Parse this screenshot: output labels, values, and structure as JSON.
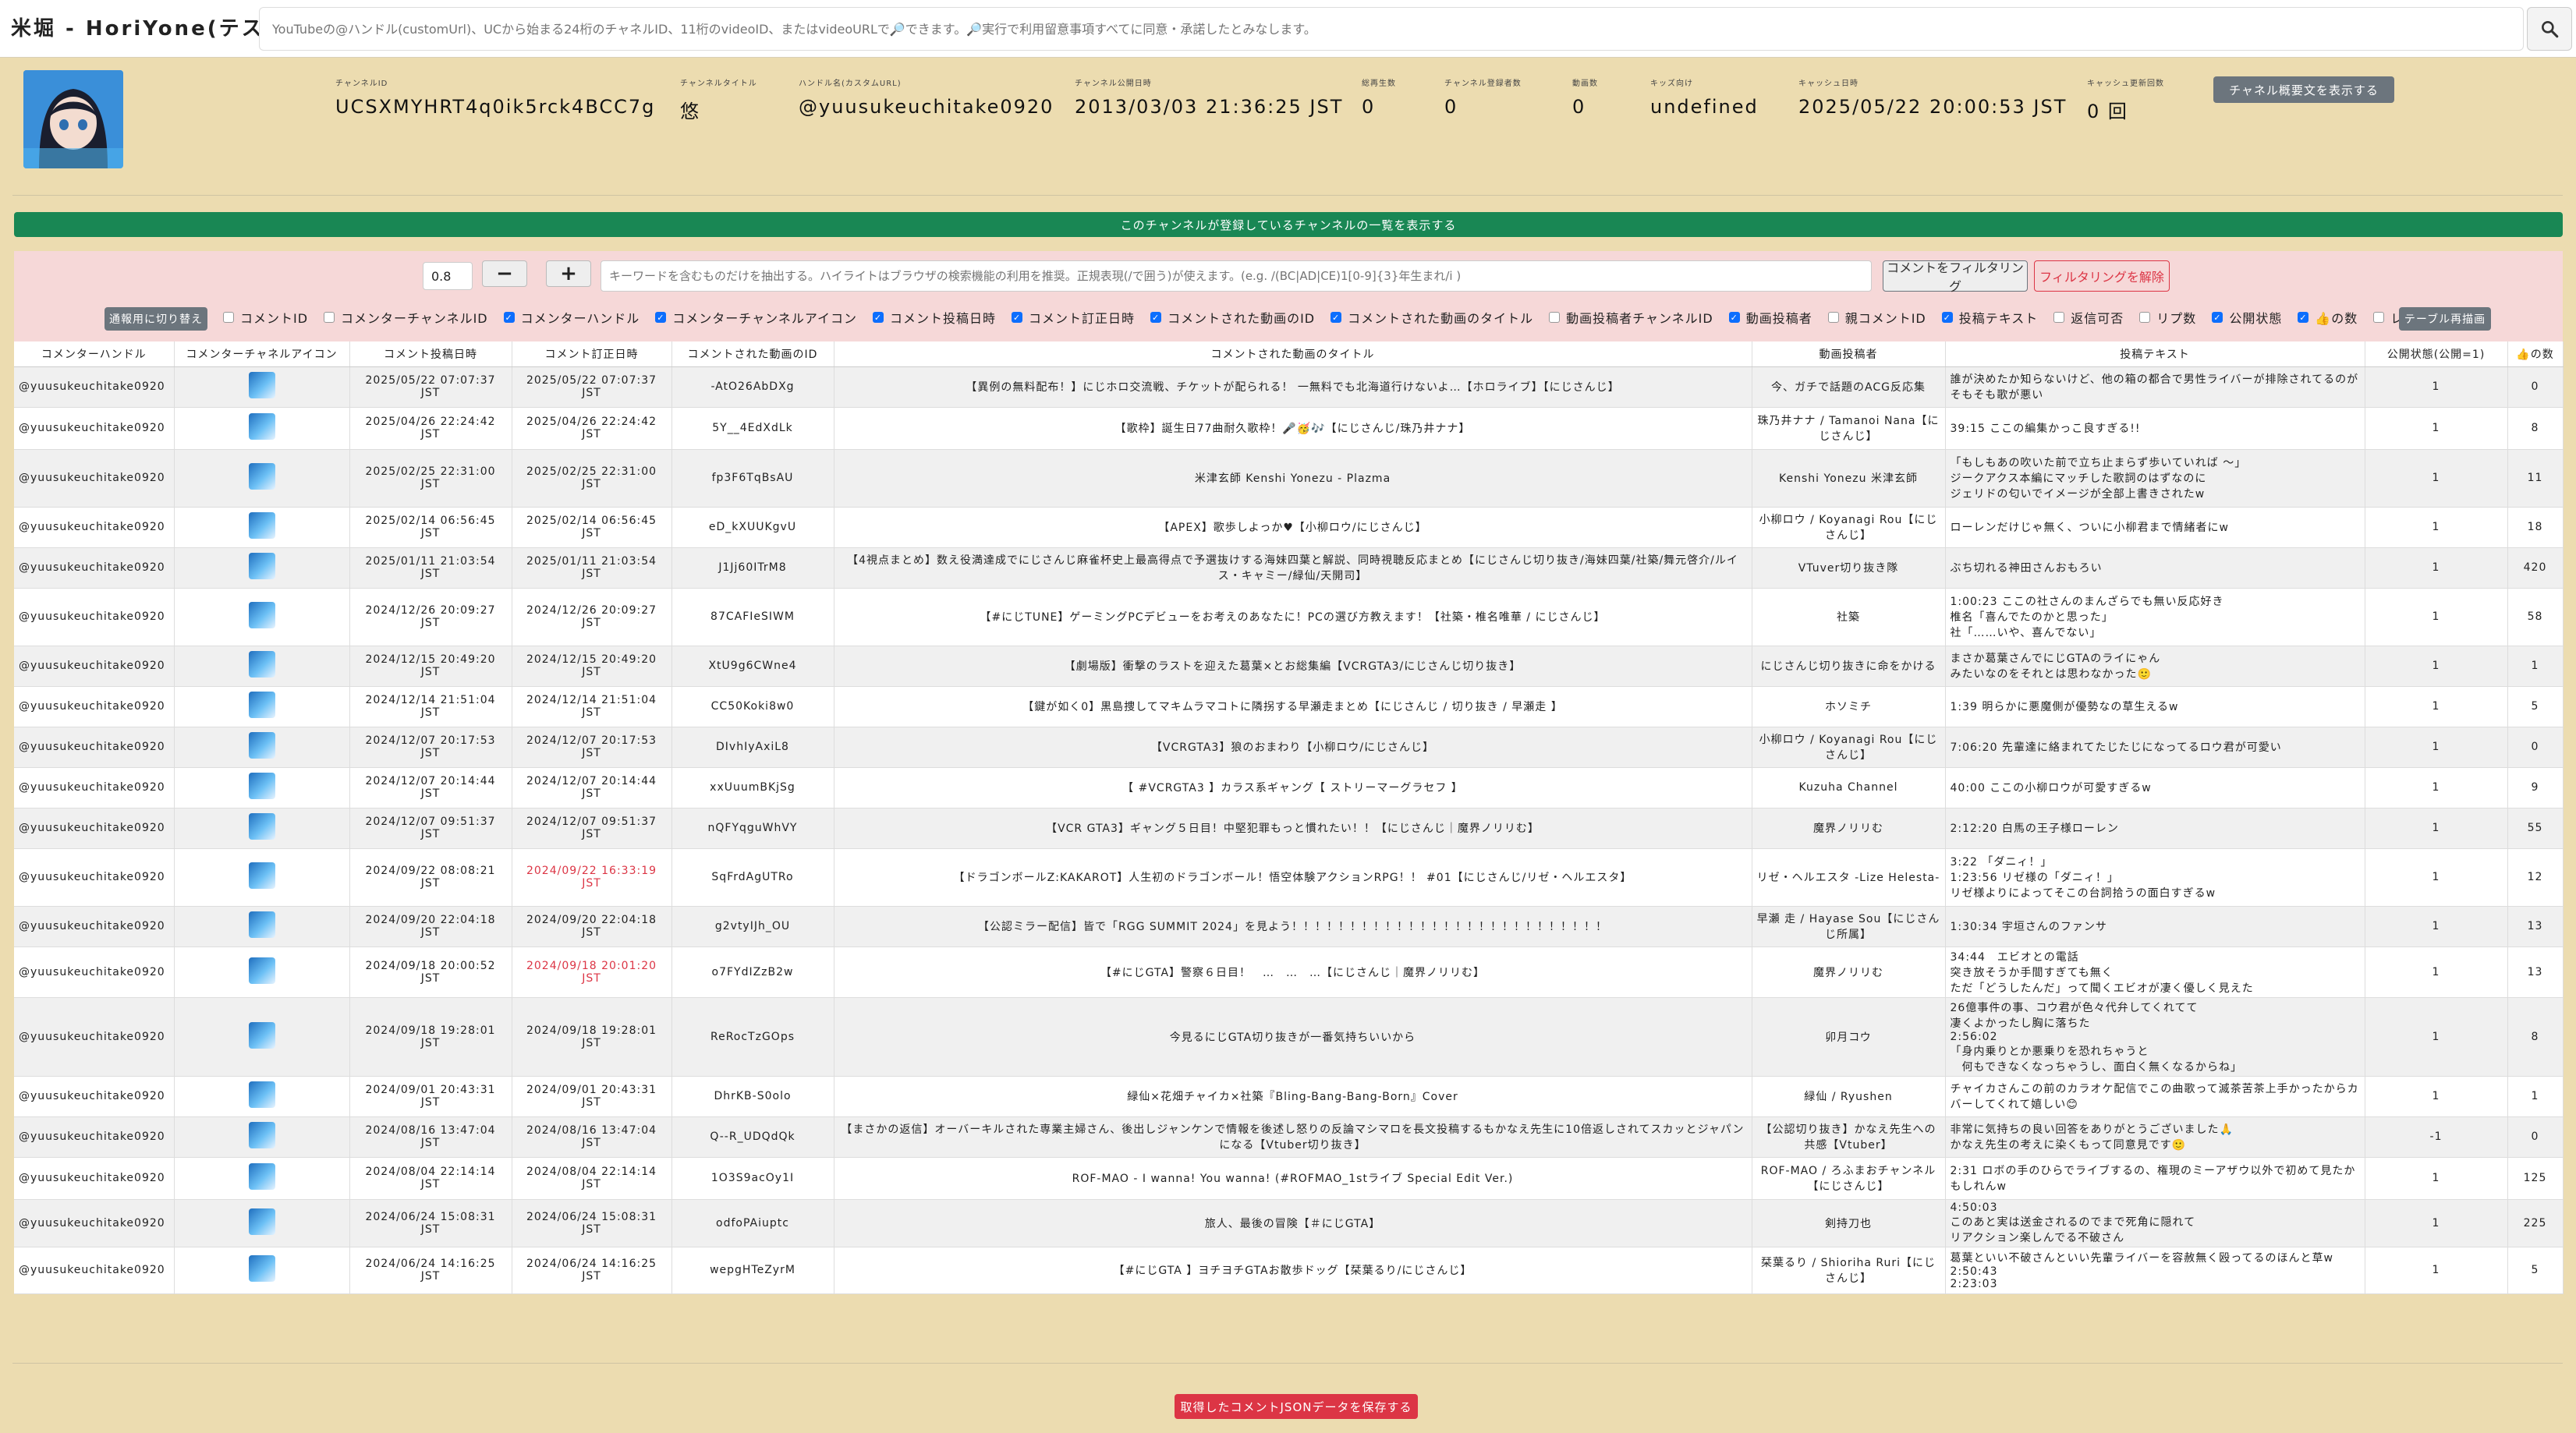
{
  "app": {
    "title": "米堀 - HoriYone(テスト中)",
    "search_placeholder": "YouTubeの@ハンドル(customUrl)、UCから始まる24桁のチャネルID、11桁のvideoID、またはvideoURLで🔎できます。🔎実行で利用留意事項すべてに同意・承諾したとみなします。"
  },
  "channel": {
    "fields": [
      {
        "label": "チャンネルID",
        "value": "UCSXMYHRT4q0ik5rck4BCC7g"
      },
      {
        "label": "チャンネルタイトル",
        "value": "悠"
      },
      {
        "label": "ハンドル名(カスタムURL)",
        "value": "@yuusukeuchitake0920"
      },
      {
        "label": "チャンネル公開日時",
        "value": "2013/03/03 21:36:25 JST"
      },
      {
        "label": "総再生数",
        "value": "0"
      },
      {
        "label": "チャンネル登録者数",
        "value": "0"
      },
      {
        "label": "動画数",
        "value": "0"
      },
      {
        "label": "キッズ向け",
        "value": "undefined"
      },
      {
        "label": "キャッシュ日時",
        "value": "2025/05/22 20:00:53 JST"
      },
      {
        "label": "キャッシュ更新回数",
        "value": "0 回"
      }
    ],
    "show_desc_button": "チャネル概要文を表示する"
  },
  "subscriptions_bar": "このチャンネルが登録しているチャンネルの一覧を表示する",
  "filter": {
    "threshold": "0.8",
    "minus": "−",
    "plus": "+",
    "keyword_placeholder": "キーワードを含むものだけを抽出する。ハイライトはブラウザの検索機能の利用を推奨。正規表現(/で囲う)が使えます。(e.g. /(BC|AD|CE)1[0-9]{3}年生まれ/i )",
    "filter_button": "コメントをフィルタリング",
    "clear_button": "フィルタリングを解除",
    "toggle_button": "通報用に切り替え",
    "redraw_button": "テーブル再描画"
  },
  "columns_toggle": [
    {
      "label": "コメントID",
      "checked": false
    },
    {
      "label": "コメンターチャンネルID",
      "checked": false
    },
    {
      "label": "コメンターハンドル",
      "checked": true
    },
    {
      "label": "コメンターチャンネルアイコン",
      "checked": true
    },
    {
      "label": "コメント投稿日時",
      "checked": true
    },
    {
      "label": "コメント訂正日時",
      "checked": true
    },
    {
      "label": "コメントされた動画のID",
      "checked": true
    },
    {
      "label": "コメントされた動画のタイトル",
      "checked": true
    },
    {
      "label": "動画投稿者チャンネルID",
      "checked": false
    },
    {
      "label": "動画投稿者",
      "checked": true
    },
    {
      "label": "親コメントID",
      "checked": false
    },
    {
      "label": "投稿テキスト",
      "checked": true
    },
    {
      "label": "返信可否",
      "checked": false
    },
    {
      "label": "リプ数",
      "checked": false
    },
    {
      "label": "公開状態",
      "checked": true
    },
    {
      "label": "👍の数",
      "checked": true
    },
    {
      "label": "レーティング",
      "checked": false
    }
  ],
  "table": {
    "headers": [
      "コメンターハンドル",
      "コメンターチャネルアイコン",
      "コメント投稿日時",
      "コメント訂正日時",
      "コメントされた動画のID",
      "コメントされた動画のタイトル",
      "動画投稿者",
      "投稿テキスト",
      "公開状態(公開=1)",
      "👍の数"
    ],
    "rows": [
      {
        "handle": "@yuusukeuchitake0920",
        "posted": "2025/05/22 07:07:37 JST",
        "edited": "2025/05/22 07:07:37 JST",
        "edited_red": false,
        "vid": "-AtO26AbDXg",
        "title": "【異例の無料配布！】にじホロ交流戦、チケットが配られる！ 一無料でも北海道行けないよ…【ホロライブ】【にじさんじ】",
        "author": "今、ガチで話題のACG反応集",
        "text": "誰が決めたか知らないけど、他の箱の都合で男性ライバーが排除されてるのがそもそも歌が悪い",
        "pub": "1",
        "likes": "0"
      },
      {
        "handle": "@yuusukeuchitake0920",
        "posted": "2025/04/26 22:24:42 JST",
        "edited": "2025/04/26 22:24:42 JST",
        "edited_red": false,
        "vid": "5Y__4EdXdLk",
        "title": "【歌枠】誕生日77曲耐久歌枠！🎤🥳🎶【にじさんじ/珠乃井ナナ】",
        "author": "珠乃井ナナ / Tamanoi Nana【にじさんじ】",
        "text": "39:15 ここの編集かっこ良すぎる!!",
        "pub": "1",
        "likes": "8"
      },
      {
        "handle": "@yuusukeuchitake0920",
        "posted": "2025/02/25 22:31:00 JST",
        "edited": "2025/02/25 22:31:00 JST",
        "edited_red": false,
        "vid": "fp3F6TqBsAU",
        "title": "米津玄師 Kenshi Yonezu - Plazma",
        "author": "Kenshi Yonezu 米津玄師",
        "text": "「もしもあの吹いた前で立ち止まらず歩いていれば ～」\nジークアクス本編にマッチした歌詞のはずなのに\nジェリドの匂いでイメージが全部上書きされたw",
        "pub": "1",
        "likes": "11"
      },
      {
        "handle": "@yuusukeuchitake0920",
        "posted": "2025/02/14 06:56:45 JST",
        "edited": "2025/02/14 06:56:45 JST",
        "edited_red": false,
        "vid": "eD_kXUUKgvU",
        "title": "【APEX】歌歩しよっか♥【小柳ロウ/にじさんじ】",
        "author": "小柳ロウ / Koyanagi Rou【にじさんじ】",
        "text": "ローレンだけじゃ無く、ついに小柳君まで情緒者にw",
        "pub": "1",
        "likes": "18"
      },
      {
        "handle": "@yuusukeuchitake0920",
        "posted": "2025/01/11 21:03:54 JST",
        "edited": "2025/01/11 21:03:54 JST",
        "edited_red": false,
        "vid": "J1Jj60ITrM8",
        "title": "【4視点まとめ】数え役満達成でにじさんじ麻雀杯史上最高得点で予選抜けする海妹四葉と解説、同時視聴反応まとめ【にじさんじ切り抜き/海妹四葉/社築/舞元啓介/ルイス・キャミー/緑仙/天開司】",
        "author": "VTuver切り抜き隊",
        "text": "ぶち切れる神田さんおもろい",
        "pub": "1",
        "likes": "420"
      },
      {
        "handle": "@yuusukeuchitake0920",
        "posted": "2024/12/26 20:09:27 JST",
        "edited": "2024/12/26 20:09:27 JST",
        "edited_red": false,
        "vid": "87CAFIeSIWM",
        "title": "【#にじTUNE】ゲーミングPCデビューをお考えのあなたに！PCの選び方教えます！【社築・椎名唯華 / にじさんじ】",
        "author": "社築",
        "text": "1:00:23 ここの社さんのまんざらでも無い反応好き\n椎名「喜んでたのかと思った」\n社「……いや、喜んでない」",
        "pub": "1",
        "likes": "58"
      },
      {
        "handle": "@yuusukeuchitake0920",
        "posted": "2024/12/15 20:49:20 JST",
        "edited": "2024/12/15 20:49:20 JST",
        "edited_red": false,
        "vid": "XtU9g6CWne4",
        "title": "【劇場版】衝撃のラストを迎えた葛葉×とお総集編【VCRGTA3/にじさんじ切り抜き】",
        "author": "にじさんじ切り抜きに命をかける",
        "text": "まさか葛葉さんでにじGTAのライにゃん\nみたいなのをそれとは思わなかった🙂",
        "pub": "1",
        "likes": "1"
      },
      {
        "handle": "@yuusukeuchitake0920",
        "posted": "2024/12/14 21:51:04 JST",
        "edited": "2024/12/14 21:51:04 JST",
        "edited_red": false,
        "vid": "CC50Koki8w0",
        "title": "【鍵が如く0】黒島捜してマキムラマコトに隣拐する早瀬走まとめ【にじさんじ / 切り抜き / 早瀬走 】",
        "author": "ホソミチ",
        "text": "1:39 明らかに悪魔側が優勢なの草生えるw",
        "pub": "1",
        "likes": "5"
      },
      {
        "handle": "@yuusukeuchitake0920",
        "posted": "2024/12/07 20:17:53 JST",
        "edited": "2024/12/07 20:17:53 JST",
        "edited_red": false,
        "vid": "DIvhIyAxiL8",
        "title": "【VCRGTA3】狼のおまわり【小柳ロウ/にじさんじ】",
        "author": "小柳ロウ / Koyanagi Rou【にじさんじ】",
        "text": "7:06:20 先輩達に絡まれてたじたじになってるロウ君が可愛い",
        "pub": "1",
        "likes": "0"
      },
      {
        "handle": "@yuusukeuchitake0920",
        "posted": "2024/12/07 20:14:44 JST",
        "edited": "2024/12/07 20:14:44 JST",
        "edited_red": false,
        "vid": "xxUuumBKjSg",
        "title": "【 #VCRGTA3 】カラス系ギャング【 ストリーマーグラセフ 】",
        "author": "Kuzuha Channel",
        "text": "40:00 ここの小柳ロウが可愛すぎるw",
        "pub": "1",
        "likes": "9"
      },
      {
        "handle": "@yuusukeuchitake0920",
        "posted": "2024/12/07 09:51:37 JST",
        "edited": "2024/12/07 09:51:37 JST",
        "edited_red": false,
        "vid": "nQFYqguWhVY",
        "title": "【VCR GTA3】ギャング５日目！中堅犯罪もっと慣れたい！！【にじさんじ｜魔界ノリリむ】",
        "author": "魔界ノリリむ",
        "text": "2:12:20 白馬の王子様ローレン",
        "pub": "1",
        "likes": "55"
      },
      {
        "handle": "@yuusukeuchitake0920",
        "posted": "2024/09/22 08:08:21 JST",
        "edited": "2024/09/22 16:33:19 JST",
        "edited_red": true,
        "vid": "SqFrdAgUTRo",
        "title": "【ドラゴンボールZ:KAKAROT】人生初のドラゴンボール！悟空体験アクションRPG！！ #01【にじさんじ/リゼ・ヘルエスタ】",
        "author": "リゼ・ヘルエスタ -Lize Helesta-",
        "text": "3:22 「ダニィ！」\n1:23:56 リゼ様の「ダニィ！」\nリゼ様よりによってそこの台詞拾うの面白すぎるw",
        "pub": "1",
        "likes": "12"
      },
      {
        "handle": "@yuusukeuchitake0920",
        "posted": "2024/09/20 22:04:18 JST",
        "edited": "2024/09/20 22:04:18 JST",
        "edited_red": false,
        "vid": "g2vtyIJh_OU",
        "title": "【公認ミラー配信】皆で「RGG SUMMIT 2024」を見よう！！！！！！！！！！！！！！！！！！！！！！！！！！！",
        "author": "早瀬 走 / Hayase Sou【にじさんじ所属】",
        "text": "1:30:34 宇垣さんのファンサ",
        "pub": "1",
        "likes": "13"
      },
      {
        "handle": "@yuusukeuchitake0920",
        "posted": "2024/09/18 20:00:52 JST",
        "edited": "2024/09/18 20:01:20 JST",
        "edited_red": true,
        "vid": "o7FYdIZzB2w",
        "title": "【#にじGTA】警察６日目！　…　…　…【にじさんじ｜魔界ノリリむ】",
        "author": "魔界ノリリむ",
        "text": "34:44　エビオとの電話\n突き放そうか手間すぎても無く\nただ「どうしたんだ」って聞くエビオが凄く優しく見えた",
        "pub": "1",
        "likes": "13"
      },
      {
        "handle": "@yuusukeuchitake0920",
        "posted": "2024/09/18 19:28:01 JST",
        "edited": "2024/09/18 19:28:01 JST",
        "edited_red": false,
        "vid": "ReRocTzGOps",
        "title": "今見るにじGTA切り抜きが一番気持ちいいから",
        "author": "卯月コウ",
        "text": "26億事件の事、コウ君が色々代弁してくれてて\n凄くよかったし胸に落ちた\n2:56:02\n「身内乗りとか悪乗りを恐れちゃうと\n　何もできなくなっちゃうし、面白く無くなるからね」",
        "pub": "1",
        "likes": "8"
      },
      {
        "handle": "@yuusukeuchitake0920",
        "posted": "2024/09/01 20:43:31 JST",
        "edited": "2024/09/01 20:43:31 JST",
        "edited_red": false,
        "vid": "DhrKB-S0olo",
        "title": "緑仙×花畑チャイカ×社築『Bling-Bang-Bang-Born』Cover",
        "author": "緑仙 / Ryushen",
        "text": "チャイカさんこの前のカラオケ配信でこの曲歌って滅茶苦茶上手かったからカバーしてくれて嬉しい😊",
        "pub": "1",
        "likes": "1"
      },
      {
        "handle": "@yuusukeuchitake0920",
        "posted": "2024/08/16 13:47:04 JST",
        "edited": "2024/08/16 13:47:04 JST",
        "edited_red": false,
        "vid": "Q--R_UDQdQk",
        "title": "【まさかの返信】オーバーキルされた専業主婦さん、後出しジャンケンで情報を後述し怒りの反論マシマロを長文投稿するもかなえ先生に10倍返しされてスカッとジャパンになる【Vtuber切り抜き】",
        "author": "【公認切り抜き】かなえ先生への共感【Vtuber】",
        "text": "非常に気持ちの良い回答をありがとうございました🙏\nかなえ先生の考えに染くもって同意見です🙂",
        "pub": "-1",
        "likes": "0"
      },
      {
        "handle": "@yuusukeuchitake0920",
        "posted": "2024/08/04 22:14:14 JST",
        "edited": "2024/08/04 22:14:14 JST",
        "edited_red": false,
        "vid": "1O3S9acOy1I",
        "title": "ROF-MAO - I wanna! You wanna! (#ROFMAO_1stライブ Special Edit Ver.)",
        "author": "ROF-MAO / ろふまおチャンネル【にじさんじ】",
        "text": "2:31 ロボの手のひらでライブするの、権現のミーアザウ以外で初めて見たかもしれんw",
        "pub": "1",
        "likes": "125"
      },
      {
        "handle": "@yuusukeuchitake0920",
        "posted": "2024/06/24 15:08:31 JST",
        "edited": "2024/06/24 15:08:31 JST",
        "edited_red": false,
        "vid": "odfoPAiuptc",
        "title": "旅人、最後の冒険【＃にじGTA】",
        "author": "剣持刀也",
        "text": "4:50:03\nこのあと実は送金されるのでまで死角に隠れて\nリアクション楽しんでる不破さん",
        "pub": "1",
        "likes": "225"
      },
      {
        "handle": "@yuusukeuchitake0920",
        "posted": "2024/06/24 14:16:25 JST",
        "edited": "2024/06/24 14:16:25 JST",
        "edited_red": false,
        "vid": "wepgHTeZyrM",
        "title": "【#にじGTA 】ヨチヨチGTAお散歩ドッグ【栞葉るり/にじさんじ】",
        "author": "栞葉るり / Shioriha Ruri【にじさんじ】",
        "text": "葛葉といい不破さんといい先輩ライバーを容赦無く殴ってるのほんと草w\n2:50:43\n2:23:03",
        "pub": "1",
        "likes": "5"
      }
    ]
  },
  "save_button": "取得したコメントJSONデータを保存する"
}
